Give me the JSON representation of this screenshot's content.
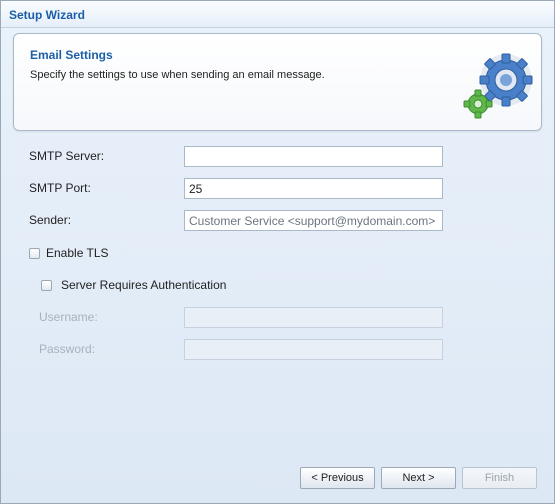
{
  "window": {
    "title": "Setup Wizard"
  },
  "header": {
    "title": "Email Settings",
    "description": "Specify the settings to use when sending an email message."
  },
  "form": {
    "smtp_server": {
      "label": "SMTP Server:",
      "value": ""
    },
    "smtp_port": {
      "label": "SMTP Port:",
      "value": "25"
    },
    "sender": {
      "label": "Sender:",
      "value": "Customer Service <support@mydomain.com>"
    },
    "enable_tls": {
      "label": "Enable TLS",
      "checked": false
    },
    "requires_auth": {
      "label": "Server Requires Authentication",
      "checked": false
    },
    "username": {
      "label": "Username:",
      "value": ""
    },
    "password": {
      "label": "Password:",
      "value": ""
    }
  },
  "buttons": {
    "previous": "< Previous",
    "next": "Next >",
    "finish": "Finish"
  },
  "colors": {
    "accent": "#1b5fa8",
    "gear_blue": "#4a7fc9",
    "gear_green": "#5fb84a"
  }
}
